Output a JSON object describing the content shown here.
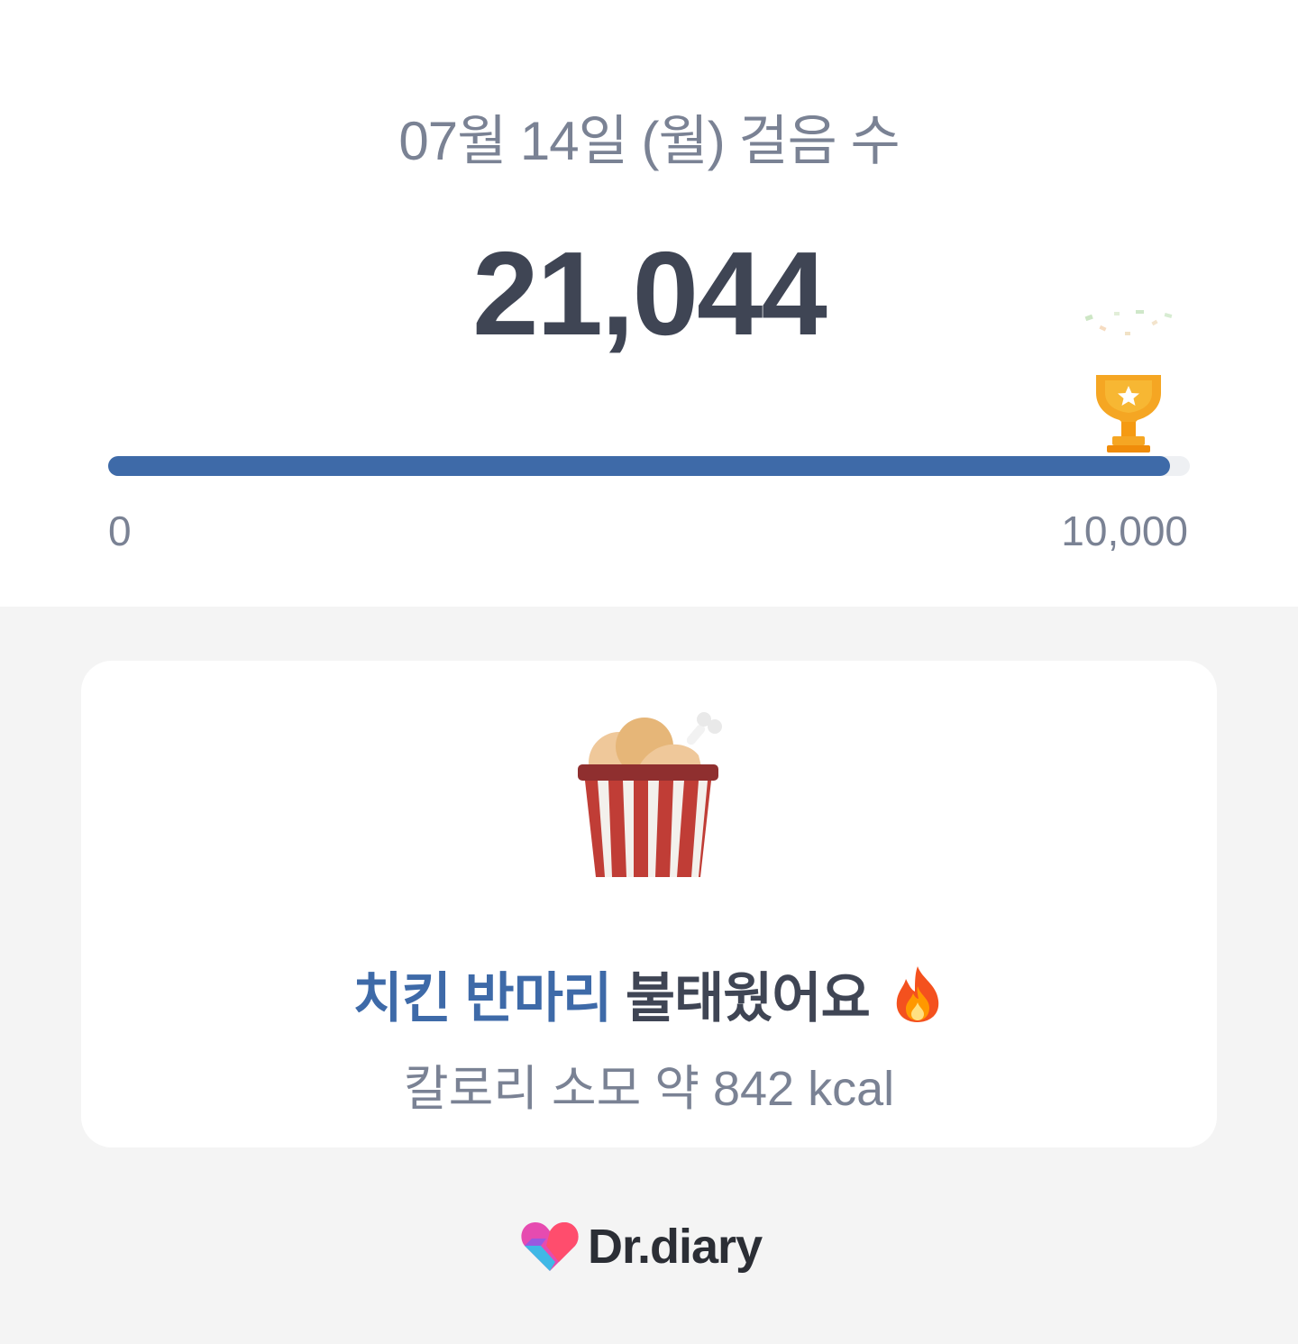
{
  "header": {
    "date_title": "07월 14일 (월) 걸음 수",
    "steps_display": "21,044"
  },
  "progress": {
    "min_label": "0",
    "max_label": "10,000",
    "fraction": 1.0,
    "goal_icon": "trophy-icon"
  },
  "card": {
    "illustration": "chicken-bucket-icon",
    "headline_highlight": "치킨 반마리",
    "headline_rest": " 불태웠어요 ",
    "headline_emoji": "fire-icon",
    "calorie_text": "칼로리 소모 약 842 kcal"
  },
  "footer": {
    "brand": "Dr.diary",
    "brand_icon": "heart-logo-icon"
  },
  "colors": {
    "accent": "#3e6aa8",
    "text_dark": "#3f4554",
    "text_muted": "#7a8294",
    "background": "#f4f4f4",
    "trophy": "#f5a623"
  }
}
